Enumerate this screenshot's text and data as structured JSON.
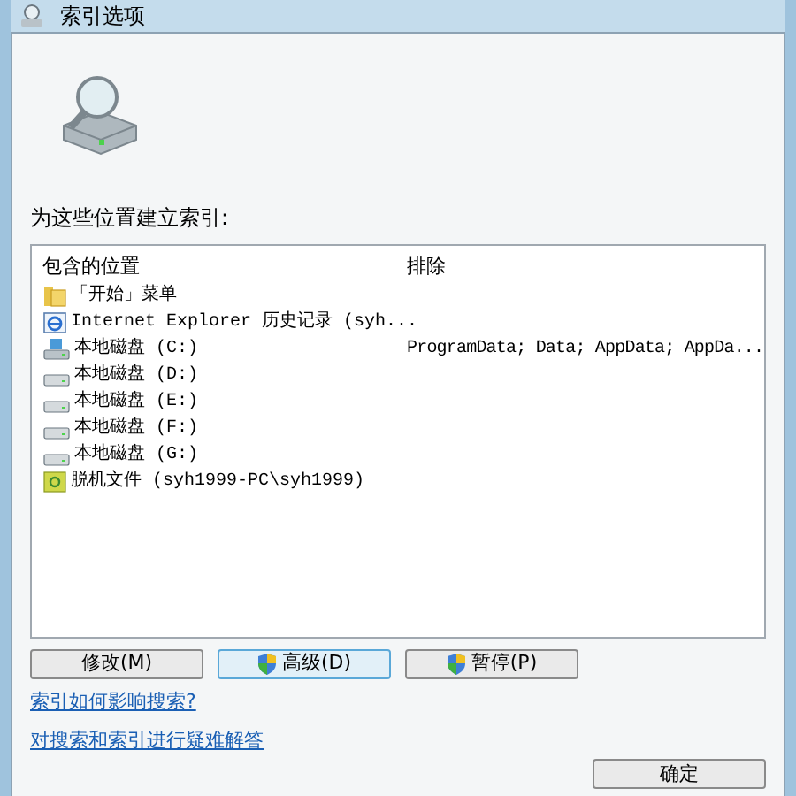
{
  "window": {
    "title": "索引选项"
  },
  "list_label": "为这些位置建立索引:",
  "table": {
    "columns": [
      "包含的位置",
      "排除"
    ],
    "rows": [
      {
        "kind": "folder",
        "location": "「开始」菜单"
      },
      {
        "kind": "browser",
        "location": "Internet Explorer 历史记录 (syh..."
      },
      {
        "kind": "system-drive",
        "location": "本地磁盘 (C:)",
        "exclude": "ProgramData; Data; AppData; AppDa..."
      },
      {
        "kind": "drive",
        "location": "本地磁盘 (D:)"
      },
      {
        "kind": "drive",
        "location": "本地磁盘 (E:)"
      },
      {
        "kind": "drive",
        "location": "本地磁盘 (F:)"
      },
      {
        "kind": "drive",
        "location": "本地磁盘 (G:)"
      },
      {
        "kind": "offline",
        "location": "脱机文件 (syh1999-PC\\syh1999)"
      }
    ]
  },
  "buttons": [
    {
      "label": "修改(M)",
      "shield": false,
      "focused": false
    },
    {
      "label": "高级(D)",
      "shield": true,
      "focused": true
    },
    {
      "label": "暂停(P)",
      "shield": true,
      "focused": false
    }
  ],
  "links": [
    "索引如何影响搜索?",
    "对搜索和索引进行疑难解答"
  ],
  "ok_button": "确定"
}
